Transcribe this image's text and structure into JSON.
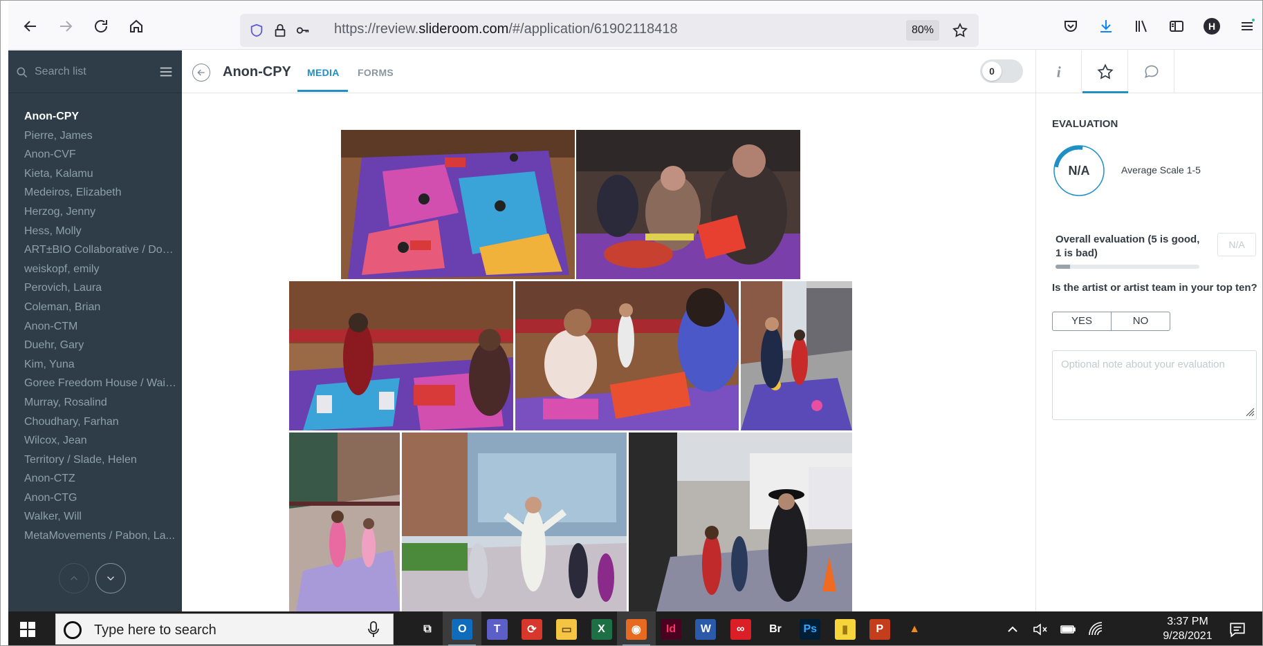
{
  "browser": {
    "url_prefix": "https://review.",
    "url_domain": "slideroom.com",
    "url_path": "/#/application/61902118418",
    "zoom": "80%",
    "profile_initial": "H"
  },
  "sidebar": {
    "search_placeholder": "Search list",
    "applicants": [
      "Anon-CPY",
      "Pierre, James",
      "Anon-CVF",
      "Kieta, Kalamu",
      "Medeiros, Elizabeth",
      "Herzog, Jenny",
      "Hess, Molly",
      "ART±BIO Collaborative / Dow...",
      "weiskopf, emily",
      "Perovich, Laura",
      "Coleman, Brian",
      "Anon-CTM",
      "Duehr, Gary",
      "Kim, Yuna",
      "Goree Freedom House / Wait...",
      "Murray, Rosalind",
      "Choudhary, Farhan",
      "Wilcox, Jean",
      "Territory / Slade, Helen",
      "Anon-CTZ",
      "Anon-CTG",
      "Walker, Will",
      "MetaMovements / Pabon, La..."
    ],
    "active_index": 0
  },
  "header": {
    "title": "Anon-CPY",
    "tabs": [
      "MEDIA",
      "FORMS"
    ],
    "toggle_value": "0"
  },
  "evaluation": {
    "heading": "EVALUATION",
    "score": "N/A",
    "scale_label": "Average Scale 1-5",
    "q1_label": "Overall evaluation (5 is good, 1 is bad)",
    "q1_value": "N/A",
    "q1_fill_fraction": 0.1,
    "q2_label": "Is the artist or artist team in your top ten?",
    "yes": "YES",
    "no": "NO",
    "note_placeholder": "Optional note about your evaluation"
  },
  "taskbar": {
    "search_placeholder": "Type here to search",
    "apps": [
      "task-view",
      "outlook",
      "teams",
      "app-red",
      "file-explorer",
      "excel",
      "firefox",
      "indesign",
      "word",
      "creative-cloud",
      "bridge",
      "photoshop",
      "sticky-notes",
      "powerpoint",
      "vlc"
    ],
    "time": "3:37 PM",
    "date": "9/28/2021"
  },
  "colors": {
    "sidebar_bg": "#2e3d48",
    "accent": "#1f8fc4",
    "taskbar_bg": "#1f1f1f"
  }
}
